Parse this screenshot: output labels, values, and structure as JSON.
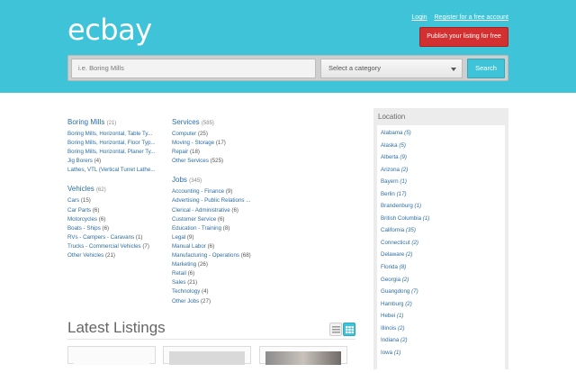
{
  "header": {
    "logo": "ecbay",
    "login_link": "Login",
    "register_link": "Register for a free account",
    "publish_button": "Publish your listing for free",
    "colors": {
      "header_bg": "#3ec3d8",
      "publish_bg": "#d33131",
      "link": "#2d6ea3"
    }
  },
  "search": {
    "placeholder": "i.e. Boring Mills",
    "category_select": "Select a category",
    "button": "Search"
  },
  "categories": [
    {
      "name": "Boring Mills",
      "count": "(21)",
      "items": [
        {
          "label": "Boring Mills, Horizontal, Table Ty...",
          "count": ""
        },
        {
          "label": "Boring Mills, Horizontal, Floor Typ...",
          "count": ""
        },
        {
          "label": "Boring Mills, Horizontal, Planer Ty...",
          "count": ""
        },
        {
          "label": "Jig Borers",
          "count": "(4)"
        },
        {
          "label": "Lathes, VTL (Vertical Turret Lathe...",
          "count": ""
        }
      ]
    },
    {
      "name": "Vehicles",
      "count": "(62)",
      "items": [
        {
          "label": "Cars",
          "count": "(15)"
        },
        {
          "label": "Car Parts",
          "count": "(6)"
        },
        {
          "label": "Motorcycles",
          "count": "(6)"
        },
        {
          "label": "Boats - Ships",
          "count": "(6)"
        },
        {
          "label": "RVs - Campers - Caravans",
          "count": "(1)"
        },
        {
          "label": "Trucks - Commercial Vehicles",
          "count": "(7)"
        },
        {
          "label": "Other Vehicles",
          "count": "(21)"
        }
      ]
    },
    {
      "name": "Services",
      "count": "(585)",
      "items": [
        {
          "label": "Computer",
          "count": "(25)"
        },
        {
          "label": "Moving - Storage",
          "count": "(17)"
        },
        {
          "label": "Repair",
          "count": "(18)"
        },
        {
          "label": "Other Services",
          "count": "(525)"
        }
      ]
    },
    {
      "name": "Jobs",
      "count": "(345)",
      "items": [
        {
          "label": "Accounting - Finance",
          "count": "(9)"
        },
        {
          "label": "Advertising - Public Relations ...",
          "count": ""
        },
        {
          "label": "Clerical - Administrative",
          "count": "(6)"
        },
        {
          "label": "Customer Service",
          "count": "(6)"
        },
        {
          "label": "Education - Training",
          "count": "(8)"
        },
        {
          "label": "Legal",
          "count": "(9)"
        },
        {
          "label": "Manual Labor",
          "count": "(6)"
        },
        {
          "label": "Manufacturing - Operations",
          "count": "(68)"
        },
        {
          "label": "Marketing",
          "count": "(26)"
        },
        {
          "label": "Retail",
          "count": "(6)"
        },
        {
          "label": "Sales",
          "count": "(21)"
        },
        {
          "label": "Technology",
          "count": "(4)"
        },
        {
          "label": "Other Jobs",
          "count": "(27)"
        }
      ]
    }
  ],
  "latest": {
    "title": "Latest Listings",
    "view_icons": [
      "list-view-icon",
      "grid-view-icon"
    ]
  },
  "location": {
    "title": "Location",
    "items": [
      {
        "name": "Alabama",
        "count": "(5)"
      },
      {
        "name": "Alaska",
        "count": "(5)"
      },
      {
        "name": "Alberta",
        "count": "(9)"
      },
      {
        "name": "Arizona",
        "count": "(2)"
      },
      {
        "name": "Bayern",
        "count": "(1)"
      },
      {
        "name": "Berlin",
        "count": "(17)"
      },
      {
        "name": "Brandenburg",
        "count": "(1)"
      },
      {
        "name": "British Columbia",
        "count": "(1)"
      },
      {
        "name": "California",
        "count": "(35)"
      },
      {
        "name": "Connecticut",
        "count": "(2)"
      },
      {
        "name": "Delaware",
        "count": "(2)"
      },
      {
        "name": "Florida",
        "count": "(8)"
      },
      {
        "name": "Georgia",
        "count": "(2)"
      },
      {
        "name": "Guangdong",
        "count": "(7)"
      },
      {
        "name": "Hamburg",
        "count": "(2)"
      },
      {
        "name": "Hebei",
        "count": "(1)"
      },
      {
        "name": "Illinois",
        "count": "(2)"
      },
      {
        "name": "Indiana",
        "count": "(2)"
      },
      {
        "name": "Iowa",
        "count": "(1)"
      }
    ]
  }
}
